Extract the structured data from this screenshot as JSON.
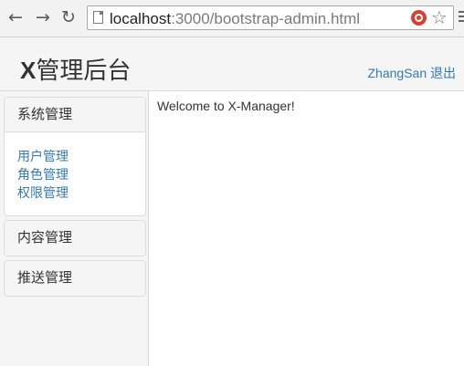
{
  "browser": {
    "url_host": "localhost",
    "url_path": ":3000/bootstrap-admin.html",
    "back_icon": "arrow-left-icon",
    "forward_icon": "arrow-right-icon",
    "reload_icon": "reload-icon",
    "page_icon": "page-icon",
    "extension_icon": "extension-icon",
    "bookmark_icon": "star-icon",
    "menu_icon": "menu-icon"
  },
  "header": {
    "brand_bold": "X",
    "brand_rest": "管理后台",
    "user_name": "ZhangSan",
    "logout_label": "退出",
    "link_color": "#337ab7"
  },
  "sidebar": {
    "panels": [
      {
        "title": "系统管理",
        "expanded": true,
        "items": [
          "用户管理",
          "角色管理",
          "权限管理"
        ]
      },
      {
        "title": "内容管理",
        "expanded": false
      },
      {
        "title": "推送管理",
        "expanded": false
      }
    ]
  },
  "main": {
    "welcome_text": "Welcome to X-Manager!"
  }
}
